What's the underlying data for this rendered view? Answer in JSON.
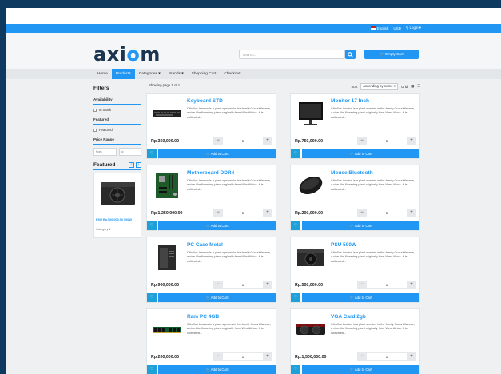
{
  "topbar": {
    "language": "English",
    "currency": "USD",
    "login": "Login"
  },
  "header": {
    "logo_text_a": "axi",
    "logo_text_o": "o",
    "logo_text_b": "m",
    "search_placeholder": "search...",
    "cart_label": "Empty Cart"
  },
  "nav": {
    "items": [
      "Home",
      "Products",
      "Categories ▾",
      "Brands ▾",
      "Shopping Cart",
      "Checkout"
    ],
    "active": "Products"
  },
  "sidebar": {
    "filters_title": "Filters",
    "availability_label": "Availability",
    "in_stock": "In Stock",
    "featured_label": "Featured",
    "featured_option": "Featured",
    "price_range_label": "Price Range",
    "price_from": "from",
    "price_to": "to",
    "featured_title": "Featured",
    "featured_item_name": "PSU Rp.500,000.00 500W",
    "featured_item_category": "Category 1"
  },
  "main": {
    "showing": "Showing page 1 of 1",
    "sort_label": "Sort",
    "sort_value": "ascending by name ▾",
    "grid_label": "Grid"
  },
  "products": [
    {
      "name": "Keyboard STD",
      "price": "Rp.350,000.00",
      "qty": "1",
      "desc": "Citrullus lanatus is a plant species in the family Cucurbitaceae, a vine-like flowering plant originally from West Africa. It is cultivated...",
      "image": "keyboard"
    },
    {
      "name": "Monitor 17 Inch",
      "price": "Rp.750,000.00",
      "qty": "1",
      "desc": "Citrullus lanatus is a plant species in the family Cucurbitaceae, a vine-like flowering plant originally from West Africa. It is cultivated...",
      "image": "monitor"
    },
    {
      "name": "Motherboard DDR4",
      "price": "Rp.1,250,000.00",
      "qty": "1",
      "desc": "Citrullus lanatus is a plant species in the family Cucurbitaceae, a vine-like flowering plant originally from West Africa. It is cultivated...",
      "image": "motherboard"
    },
    {
      "name": "Mouse Bluetooth",
      "price": "Rp.200,000.00",
      "qty": "1",
      "desc": "Citrullus lanatus is a plant species in the family Cucurbitaceae, a vine-like flowering plant originally from West Africa. It is cultivated...",
      "image": "mouse"
    },
    {
      "name": "PC Case Metal",
      "price": "Rp.900,000.00",
      "qty": "1",
      "desc": "Citrullus lanatus is a plant species in the family Cucurbitaceae, a vine-like flowering plant originally from West Africa. It is cultivated...",
      "image": "pccase"
    },
    {
      "name": "PSU 500W",
      "price": "Rp.500,000.00",
      "qty": "1",
      "desc": "Citrullus lanatus is a plant species in the family Cucurbitaceae, a vine-like flowering plant originally from West Africa. It is cultivated...",
      "image": "psu"
    },
    {
      "name": "Ram PC 4GB",
      "price": "Rp.200,000.00",
      "qty": "1",
      "desc": "Citrullus lanatus is a plant species in the family Cucurbitaceae, a vine-like flowering plant originally from West Africa. It is cultivated...",
      "image": "ram"
    },
    {
      "name": "VGA Card 2gb",
      "price": "Rp.1,500,000.00",
      "qty": "1",
      "desc": "Citrullus lanatus is a plant species in the family Cucurbitaceae, a vine-like flowering plant originally from West Africa. It is cultivated...",
      "image": "vga"
    }
  ],
  "card_labels": {
    "add_to_cart": "Add to Cart",
    "minus": "−",
    "plus": "+",
    "wish_icon": "♡"
  },
  "colors": {
    "accent": "#2196f3",
    "brand_dark": "#1b3550",
    "frame": "#0d3a5e"
  }
}
